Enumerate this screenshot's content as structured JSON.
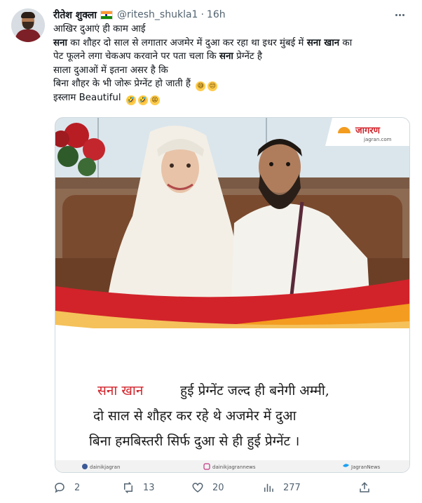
{
  "author": {
    "display_name": "रीतेश शुक्ला",
    "handle": "@ritesh_shukla1",
    "separator": "·",
    "time": "16h",
    "avatar_icon": "avatar-photo",
    "flag_icon": "india-flag-icon"
  },
  "tweet_text": {
    "line1": "आखिर दुआएं ही काम आई",
    "line2_part1": "सना",
    "line2_part2": " का शौहर दो साल से लगातार अजमेर में दुआ कर रहा था इधर मुंबई में ",
    "line2_part3": "सना खान",
    "line2_part4": " का",
    "line3_part1": "पेट फूलने लगा चेकअप करवाने पर पता चला कि ",
    "line3_part2": "सना",
    "line3_part3": " प्रेग्नेंट है",
    "line4": "साला दुआओं में इतना असर है कि",
    "line5": " बिना शौहर के भी जोरू प्रेग्नेंट हो जाती हैं ",
    "line6": "इस्लाम Beautiful ",
    "emoji_sweat_smile": "😅",
    "emoji_unamused": "😒",
    "emoji_rofl": "🤣",
    "emoji_tired": "😫"
  },
  "media": {
    "brand_name": "जागरण",
    "brand_site": "jagran.com",
    "caption_name": "सना खान",
    "caption_line1_rest": "हुई प्रेग्नेंट जल्द ही बनेगी अम्मी,",
    "caption_line2": "दो साल से शौहर कर रहे थे अजमेर में दुआ",
    "caption_line3": "बिना हमबिस्तरी सिर्फ दुआ से ही हुई प्रेग्नेंट ।",
    "social_facebook": "dainikjagran",
    "social_instagram": "dainikjagrannews",
    "social_twitter": "JagranNews"
  },
  "actions": {
    "replies": "2",
    "retweets": "13",
    "likes": "20",
    "views": "277"
  },
  "colors": {
    "text_primary": "#0f1419",
    "text_secondary": "#536471",
    "border": "#cfd9de",
    "brand_red": "#d2232a",
    "brand_orange": "#f39c1f"
  }
}
